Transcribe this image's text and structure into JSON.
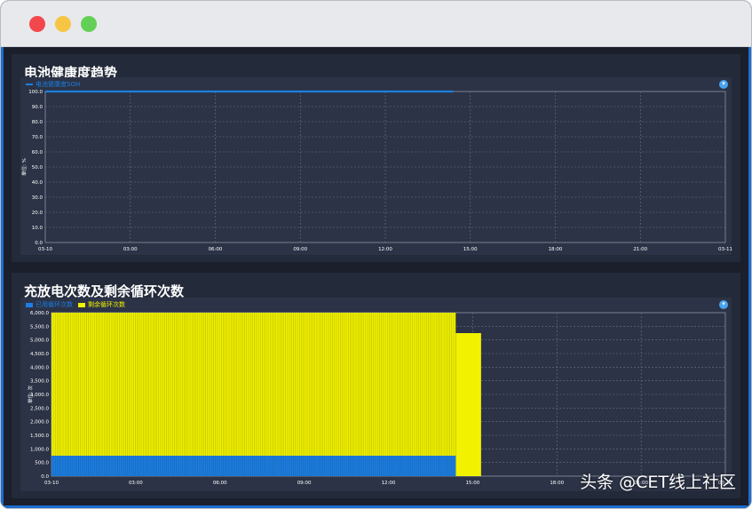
{
  "window": {
    "close_icon": "close-dot",
    "minimize_icon": "minimize-dot",
    "zoom_icon": "zoom-dot"
  },
  "panel1": {
    "title": "电池健康度趋势",
    "expand_icon": "expand-icon",
    "expand_glyph": "▾"
  },
  "panel2": {
    "title": "充放电次数及剩余循环次数",
    "expand_icon": "expand-icon",
    "expand_glyph": "▾"
  },
  "watermark": "头条 @CET线上社区",
  "chart_data": [
    {
      "type": "line",
      "title": "电池健康度趋势",
      "ylabel": "单位: %",
      "ylim": [
        0,
        100
      ],
      "yticks": [
        "0.0",
        "10.0",
        "20.0",
        "30.0",
        "40.0",
        "50.0",
        "60.0",
        "70.0",
        "80.0",
        "90.0",
        "100.0"
      ],
      "xticks": [
        "03-10",
        "03:00",
        "06:00",
        "09:00",
        "12:00",
        "15:00",
        "18:00",
        "21:00",
        "03-11"
      ],
      "xlim_hours": [
        0,
        24
      ],
      "legend_position": "top-left",
      "grid": true,
      "series": [
        {
          "name": "电池健康度SOH",
          "color": "#1c7fe0",
          "x_hours": [
            0,
            14.4
          ],
          "values": [
            100,
            100
          ]
        }
      ]
    },
    {
      "type": "bar",
      "title": "充放电次数及剩余循环次数",
      "ylabel": "单位: 次",
      "ylim": [
        0,
        6000
      ],
      "yticks": [
        "0.0",
        "500.0",
        "1,000.0",
        "1,500.0",
        "2,000.0",
        "2,500.0",
        "3,000.0",
        "3,500.0",
        "4,000.0",
        "4,500.0",
        "5,000.0",
        "5,500.0",
        "6,000.0"
      ],
      "xticks": [
        "03-10",
        "03:00",
        "06:00",
        "09:00",
        "12:00",
        "15:00",
        "18:00",
        "21:00",
        "03-11"
      ],
      "xlim_hours": [
        0,
        24
      ],
      "legend_position": "top-left",
      "grid": true,
      "stacked": true,
      "segments": [
        {
          "x_hours": [
            0,
            14.4
          ],
          "cycled": 750,
          "remaining": 5250
        },
        {
          "x_hours": [
            14.4,
            15.3
          ],
          "cycled": 0,
          "remaining": 5250
        }
      ],
      "series": [
        {
          "name": "已用循环次数",
          "color": "#1a7ee6"
        },
        {
          "name": "剩余循环次数",
          "color": "#f2f200"
        }
      ]
    }
  ]
}
